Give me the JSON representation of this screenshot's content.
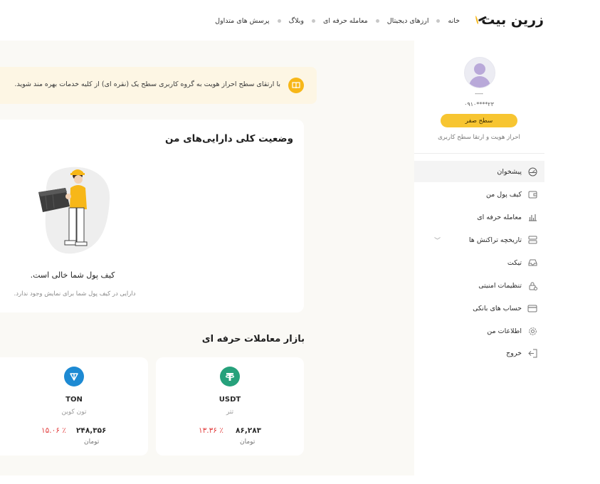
{
  "header": {
    "logo_text": "زرین بیت",
    "nav": [
      "خانه",
      "ارزهای دیجیتال",
      "معامله حرفه ای",
      "وبلاگ",
      "پرسش های متداول"
    ]
  },
  "notice": {
    "text": "با ارتقای سطح احراز هویت به گروه کاربری سطح یک (نقره ای) از کلیه خدمات بهره مند شوید."
  },
  "assets": {
    "title": "وضعیت کلی دارایی‌های من",
    "empty_title": "کیف پول شما خالی است.",
    "empty_subtitle": "دارایی در کیف پول شما برای نمایش وجود ندارد."
  },
  "market": {
    "title": "بازار معاملات حرفه ای",
    "coins": [
      {
        "symbol": "USDT",
        "name": "تتر",
        "price": "۸۶,۲۸۳",
        "change": "٪ ۱۳.۳۶",
        "unit": "تومان",
        "color": "#26a17b"
      },
      {
        "symbol": "TON",
        "name": "تون کوین",
        "price": "۲۴۸,۳۵۶",
        "change": "٪ ۱۵.۰۶",
        "unit": "تومان",
        "color": "#1d8ad3"
      }
    ]
  },
  "profile": {
    "name": "----",
    "phone": "۰۹۱۰****۲۳",
    "level_label": "سطح صفر",
    "verify_link": "احراز هویت و ارتقا سطح کاربری"
  },
  "sidebar": {
    "items": [
      {
        "label": "پیشخوان",
        "icon": "dashboard-icon",
        "active": true
      },
      {
        "label": "کیف پول من",
        "icon": "wallet-icon"
      },
      {
        "label": "معامله حرفه ای",
        "icon": "chart-icon"
      },
      {
        "label": "تاریخچه تراکنش ها",
        "icon": "history-icon",
        "has_chevron": true
      },
      {
        "label": "تیکت",
        "icon": "ticket-icon"
      },
      {
        "label": "تنظیمات امنیتی",
        "icon": "lock-icon"
      },
      {
        "label": "حساب های بانکی",
        "icon": "card-icon"
      },
      {
        "label": "اطلاعات من",
        "icon": "gear-icon"
      },
      {
        "label": "خروج",
        "icon": "logout-icon"
      }
    ]
  },
  "colors": {
    "accent": "#f7b718",
    "negative": "#e23d3d"
  }
}
